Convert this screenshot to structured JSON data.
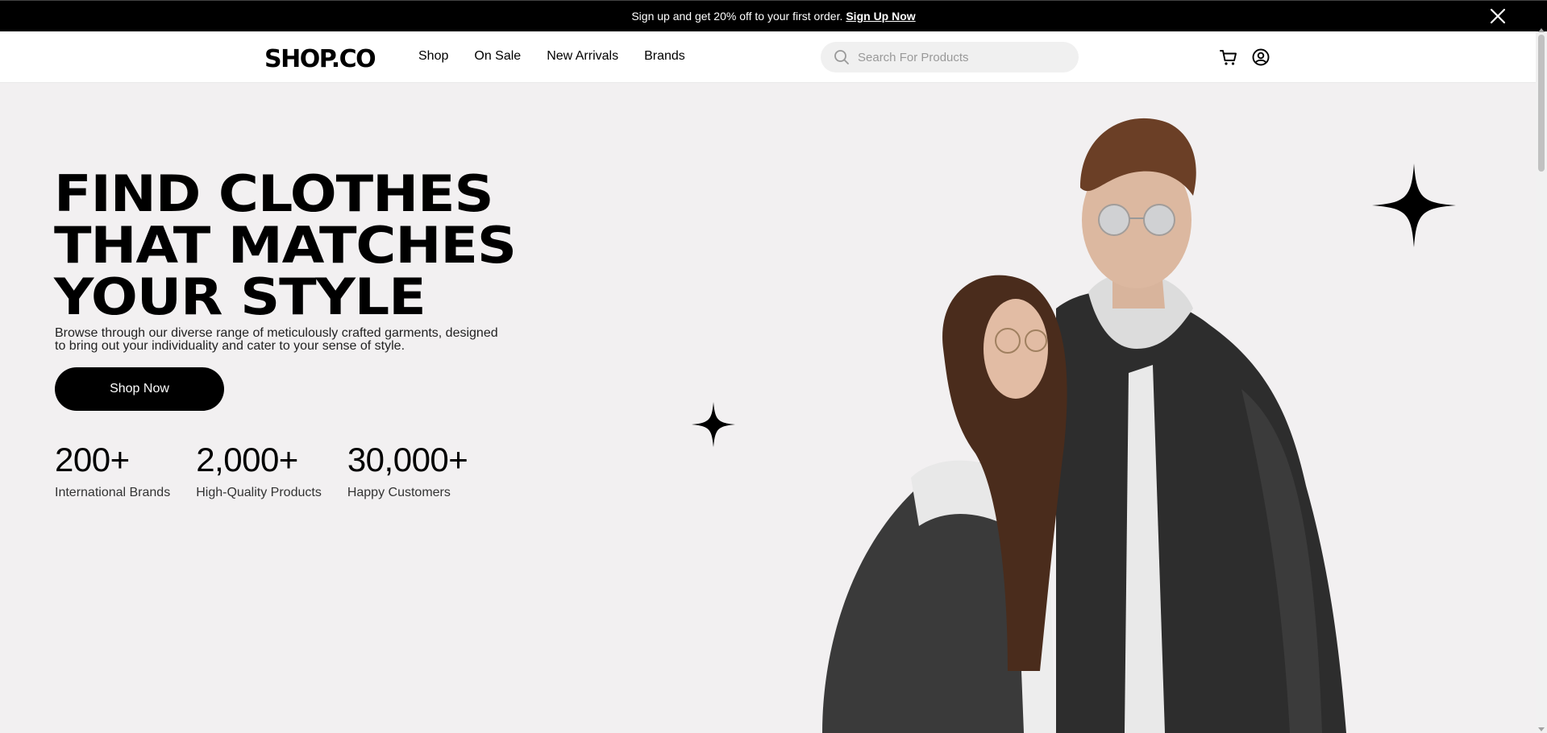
{
  "promo": {
    "text": "Sign up and get 20% off to your first order.",
    "link": "Sign Up Now",
    "close_icon": "close-icon"
  },
  "header": {
    "logo": "SHOP.CO",
    "nav": [
      {
        "label": "Shop"
      },
      {
        "label": "On Sale"
      },
      {
        "label": "New Arrivals"
      },
      {
        "label": "Brands"
      }
    ],
    "search": {
      "placeholder": "Search For Products",
      "icon": "search-icon"
    },
    "icons": [
      "cart-icon",
      "account-icon"
    ]
  },
  "hero": {
    "headline": [
      "FIND CLOTHES",
      "THAT MATCHES",
      "YOUR STYLE"
    ],
    "subtext": "Browse through our diverse range of meticulously crafted garments, designed to bring out your individuality and cater to your sense of style.",
    "cta": "Shop Now",
    "stats": [
      {
        "value": "200+",
        "label": "International Brands"
      },
      {
        "value": "2,000+",
        "label": "High-Quality Products"
      },
      {
        "value": "30,000+",
        "label": "Happy Customers"
      }
    ]
  },
  "colors": {
    "promo_bg": "#000000",
    "hero_bg": "#F2F0F1",
    "button_bg": "#000000",
    "search_bg": "#F0F0F0"
  }
}
